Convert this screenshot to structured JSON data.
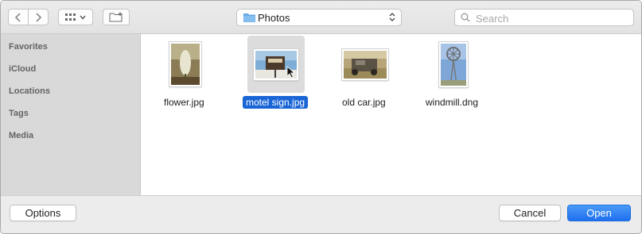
{
  "toolbar": {
    "location": "Photos",
    "search_placeholder": "Search"
  },
  "sidebar": {
    "items": [
      {
        "label": "Favorites"
      },
      {
        "label": "iCloud"
      },
      {
        "label": "Locations"
      },
      {
        "label": "Tags"
      },
      {
        "label": "Media"
      }
    ]
  },
  "files": [
    {
      "name": "flower.jpg",
      "selected": false
    },
    {
      "name": "motel sign.jpg",
      "selected": true
    },
    {
      "name": "old car.jpg",
      "selected": false
    },
    {
      "name": "windmill.dng",
      "selected": false
    }
  ],
  "buttons": {
    "options": "Options",
    "cancel": "Cancel",
    "open": "Open"
  },
  "colors": {
    "accent": "#1a65d6",
    "sidebar_bg": "#d9d9d9",
    "folder_icon": "#6aaeea"
  }
}
